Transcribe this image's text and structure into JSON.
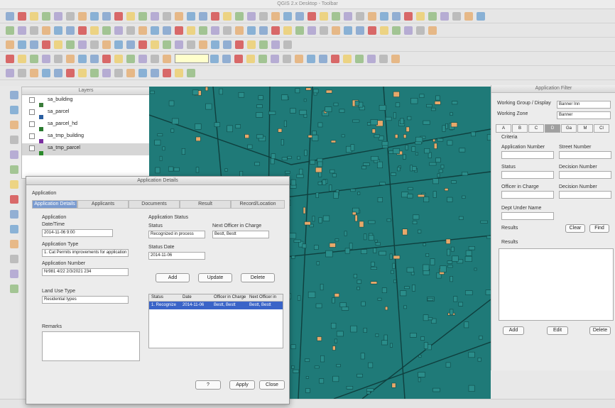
{
  "window": {
    "title": "QGIS 2.x Desktop - Toolbar"
  },
  "layers": {
    "header": "Layers",
    "items": [
      {
        "label": "sa_building",
        "swatch": "#3a7d3a"
      },
      {
        "label": "sa_parcel",
        "swatch": "#2a5ea0"
      },
      {
        "label": "sa_parcel_hd",
        "swatch": "#2a7a30"
      },
      {
        "label": "sa_tmp_building",
        "swatch": "#7a2fa0"
      },
      {
        "label": "sa_tmp_parcel",
        "swatch": "#2b8a2b"
      }
    ]
  },
  "right_panel": {
    "title": "Application Filter",
    "working_group_label": "Working Group / Display",
    "working_group_value": "Banner Inn",
    "working zone_label": "Working Zone",
    "working_zone_label": "Working Zone",
    "working_zone_value": "Banner",
    "tabs": [
      "A",
      "B",
      "C",
      "D",
      "Ga",
      "M",
      "Cl"
    ],
    "criteria_label": "Criteria",
    "app_number_label": "Application Number",
    "street_number_label": "Street Number",
    "status_label": "Status",
    "decision_label": "Decision Number",
    "officer_label": "Officer in Charge",
    "decision_num_label": "Decision Number",
    "dept_label": "Dept Under Name",
    "results_label": "Results",
    "clear_button": "Clear",
    "find_button": "Find",
    "add_button": "Add",
    "edit_button": "Edit",
    "delete_button": "Delete"
  },
  "dialog": {
    "title": "Application Details",
    "section": "Application",
    "tabs": [
      "Application Details",
      "Applicants",
      "Documents",
      "Result",
      "Record/Location"
    ],
    "application_label": "Application",
    "date_time_label": "Date/Time",
    "date_time_value": "2014-11-06   9:00",
    "app_type_label": "Application Type",
    "app_type_value": "1. Cat Permits improvements for application",
    "app_number_label": "Application Number",
    "app_number_value": "Nr981    4/22  2/3/2021    234",
    "land_use_label": "Land Use Type",
    "land_use_value": "Residential types",
    "remarks_label": "Remarks",
    "status_section": "Application Status",
    "status_label": "Status",
    "status_value": "Recognized in process",
    "next_officer_label": "Next Officer in Charge",
    "next_officer_value": "Bestt, Bestt",
    "status_date_label": "Status Date",
    "status_date_value": "2014-11-06",
    "add_button": "Add",
    "update_button": "Update",
    "delete_button": "Delete",
    "grid_headers": [
      "Status",
      "Date",
      "Officer in Charge",
      "Next Officer in"
    ],
    "grid_row": [
      "1. Recognize",
      "2014-11-06",
      "Bestt, Bestt",
      "Bestt, Bestt"
    ],
    "help_button": "?",
    "apply_button": "Apply",
    "close_button": "Close"
  }
}
